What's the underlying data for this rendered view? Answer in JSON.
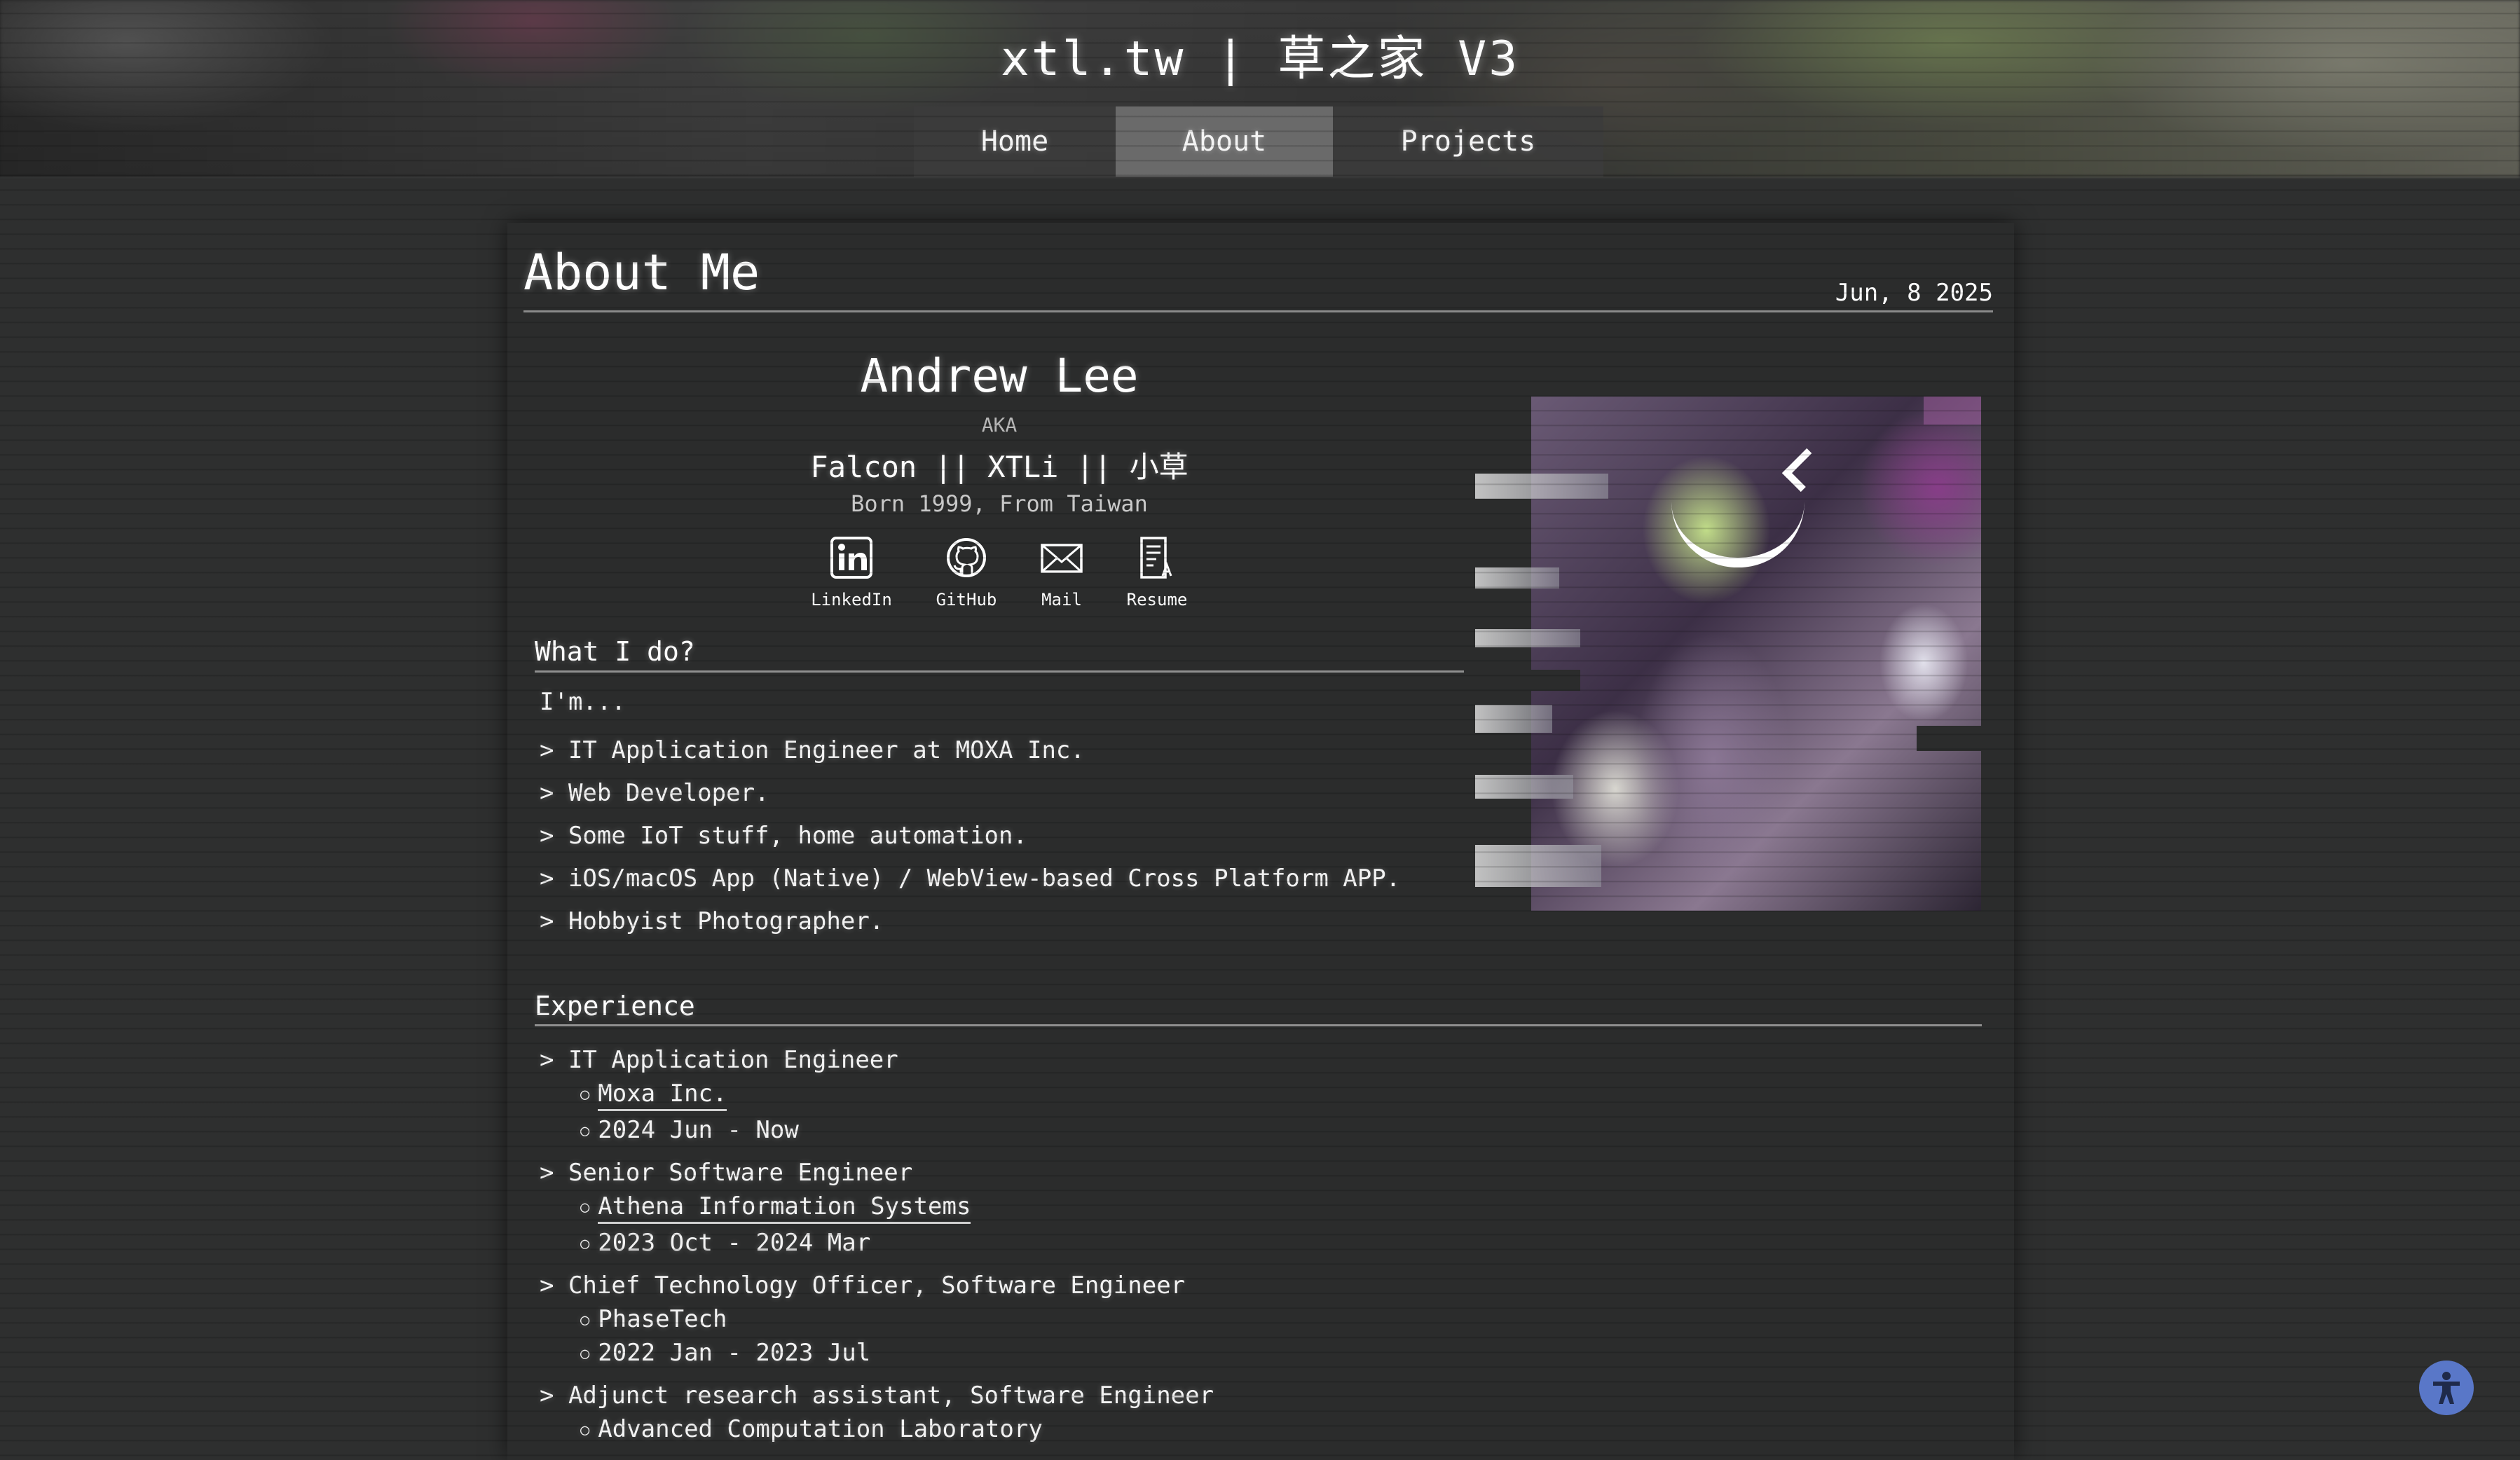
{
  "header": {
    "site_title": "xtl.tw | 草之家 V3",
    "nav": [
      {
        "label": "Home"
      },
      {
        "label": "About",
        "active": true
      },
      {
        "label": "Projects"
      }
    ]
  },
  "page": {
    "title": "About Me",
    "date": "Jun, 8 2025"
  },
  "profile": {
    "name": "Andrew Lee",
    "aka": "AKA",
    "aliases": "Falcon || XTLi || 小草",
    "born": "Born 1999, From Taiwan",
    "links": [
      {
        "label": "LinkedIn",
        "icon": "linkedin-icon"
      },
      {
        "label": "GitHub",
        "icon": "github-icon"
      },
      {
        "label": "Mail",
        "icon": "mail-icon"
      },
      {
        "label": "Resume",
        "icon": "resume-icon"
      }
    ]
  },
  "what_i_do": {
    "heading": "What I do?",
    "intro": "I'm...",
    "items": [
      "> IT Application Engineer at MOXA Inc.",
      "> Web Developer.",
      "> Some IoT stuff, home automation.",
      "> iOS/macOS App (Native) / WebView-based Cross Platform APP.",
      "> Hobbyist Photographer."
    ]
  },
  "experience": {
    "heading": "Experience",
    "items": [
      {
        "role": "> IT Application Engineer",
        "org": "Moxa Inc.",
        "org_link": true,
        "period": "2024 Jun - Now"
      },
      {
        "role": "> Senior Software Engineer",
        "org": "Athena Information Systems",
        "org_link": true,
        "period": "2023 Oct - 2024 Mar"
      },
      {
        "role": "> Chief Technology Officer, Software Engineer",
        "org": "PhaseTech",
        "org_link": false,
        "period": "2022 Jan - 2023 Jul"
      },
      {
        "role": "> Adjunct research assistant, Software Engineer",
        "org": "Advanced Computation Laboratory",
        "org_link": false
      }
    ],
    "bullet": "○"
  },
  "accessibility": {
    "icon": "accessibility-icon"
  },
  "colors": {
    "background": "#2e2f2f",
    "card": "#2b2c2c",
    "nav_active": "#6a6a6a",
    "accessibility_button": "#5977c8"
  }
}
